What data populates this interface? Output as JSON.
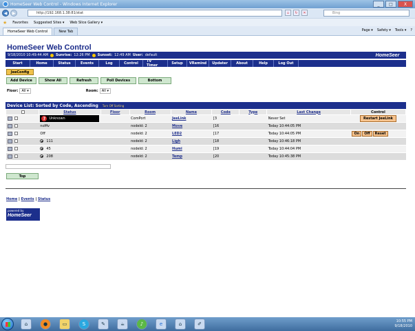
{
  "window": {
    "title": "HomeSeer Web Control - Windows Internet Explorer",
    "min": "_",
    "max": "□",
    "close": "X"
  },
  "browser": {
    "url": "http://192.168.1.38:81/stat",
    "search_placeholder": "Bing",
    "favorites_label": "Favorites",
    "fav_items": [
      "Suggested Sites ▾",
      "Web Slice Gallery ▾"
    ],
    "tabs": [
      "HomeSeer Web Control",
      "New Tab"
    ],
    "commands": [
      "Page ▾",
      "Safety ▾",
      "Tools ▾",
      "?"
    ]
  },
  "header": {
    "title": "HomeSeer Web Control",
    "datetime": "9/18/2010 10:49:44 AM",
    "sunrise_label": "Sunrise:",
    "sunrise": "12:26 PM",
    "sunset_label": "Sunset:",
    "sunset": "12:49 AM",
    "user_label": "User:",
    "user": "default",
    "logo": "HomeSeer"
  },
  "menu": [
    "Start",
    "Home",
    "Status",
    "Events",
    "Log",
    "Control",
    "TV Timer",
    "Setup",
    "VRemind",
    "Updater",
    "About",
    "Help",
    "Log Out"
  ],
  "jeeconfig": "JeeConfig",
  "actions": [
    "Add Device",
    "Show All",
    "Refresh",
    "Poll Devices",
    "Bottom"
  ],
  "filters": {
    "floor_label": "Floor:",
    "floor_value": "All",
    "room_label": "Room:",
    "room_value": "All"
  },
  "device_list": {
    "title": "Device List: Sorted by Code, Ascending",
    "sort_toggle": "Turn Off Sorting",
    "columns": [
      "Status",
      "Floor",
      "Room",
      "Name",
      "Code",
      "Type",
      "Last Change",
      "Control"
    ],
    "rows": [
      {
        "status": "Unknown",
        "floor": "",
        "room": "ComPort",
        "name": "JeeLink",
        "code": "[3",
        "type": "",
        "last": "Never Set",
        "control": "Restart JeeLink"
      },
      {
        "status": "noMv",
        "floor": "",
        "room": "nodeId: 2",
        "name": "Move",
        "code": "[16",
        "type": "",
        "last": "Today 10:44:05 PM",
        "control": ""
      },
      {
        "status": "Off",
        "floor": "",
        "room": "nodeId: 2",
        "name": "LED2",
        "code": "[17",
        "type": "",
        "last": "Today 10:44:05 PM",
        "control": "On|Off|Reset"
      },
      {
        "status": "111",
        "floor": "",
        "room": "nodeId: 2",
        "name": "Ligh",
        "code": "[18",
        "type": "",
        "last": "Today 10:46:18 PM",
        "control": ""
      },
      {
        "status": "45",
        "floor": "",
        "room": "nodeId: 2",
        "name": "Humi",
        "code": "[19",
        "type": "",
        "last": "Today 10:44:04 PM",
        "control": ""
      },
      {
        "status": "208",
        "floor": "",
        "room": "nodeId: 2",
        "name": "Temp",
        "code": "[20",
        "type": "",
        "last": "Today 10:45:38 PM",
        "control": ""
      }
    ]
  },
  "top_button": "Top",
  "footer": {
    "links": [
      "Home",
      "Events",
      "Status"
    ],
    "sep": "|",
    "powered": "powered by",
    "powered_logo": "HomeSeer"
  },
  "taskbar": {
    "time": "10:55 PM",
    "date": "9/18/2010"
  }
}
